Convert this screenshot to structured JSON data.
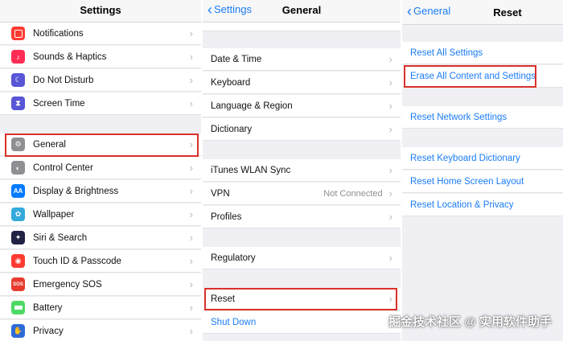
{
  "settings": {
    "title": "Settings",
    "items": [
      {
        "label": "Notifications",
        "icon": "notifications-icon",
        "color": "#ff3b30",
        "glyph": "▢"
      },
      {
        "label": "Sounds & Haptics",
        "icon": "sounds-icon",
        "color": "#ff2d55",
        "glyph": "🔊"
      },
      {
        "label": "Do Not Disturb",
        "icon": "moon-icon",
        "color": "#5856d6",
        "glyph": "☾"
      },
      {
        "label": "Screen Time",
        "icon": "hourglass-icon",
        "color": "#5856d6",
        "glyph": "⧗"
      },
      {
        "label": "General",
        "icon": "gear-icon",
        "color": "#8e8e93",
        "glyph": "⚙"
      },
      {
        "label": "Control Center",
        "icon": "toggles-icon",
        "color": "#8e8e93",
        "glyph": "◐"
      },
      {
        "label": "Display & Brightness",
        "icon": "display-icon",
        "color": "#007aff",
        "glyph": "AA"
      },
      {
        "label": "Wallpaper",
        "icon": "wallpaper-icon",
        "color": "#34aadc",
        "glyph": "✿"
      },
      {
        "label": "Siri & Search",
        "icon": "siri-icon",
        "color": "#222244",
        "glyph": "✦"
      },
      {
        "label": "Touch ID & Passcode",
        "icon": "fingerprint-icon",
        "color": "#ff3b30",
        "glyph": "◉"
      },
      {
        "label": "Emergency SOS",
        "icon": "sos-icon",
        "color": "#e63b2e",
        "glyph": "SOS"
      },
      {
        "label": "Battery",
        "icon": "battery-icon",
        "color": "#4cd964",
        "glyph": "▬"
      },
      {
        "label": "Privacy",
        "icon": "hand-icon",
        "color": "#2f6bd8",
        "glyph": "✋"
      }
    ]
  },
  "general": {
    "back_label": "Settings",
    "title": "General",
    "partial_text": "...",
    "items": [
      {
        "label": "Date & Time"
      },
      {
        "label": "Keyboard"
      },
      {
        "label": "Language & Region"
      },
      {
        "label": "Dictionary"
      },
      {
        "label": "iTunes WLAN Sync"
      },
      {
        "label": "VPN",
        "value": "Not Connected"
      },
      {
        "label": "Profiles"
      },
      {
        "label": "Regulatory"
      },
      {
        "label": "Reset"
      },
      {
        "label": "Shut Down"
      }
    ]
  },
  "reset": {
    "back_label": "General",
    "title": "Reset",
    "items": [
      {
        "label": "Reset All Settings"
      },
      {
        "label": "Erase All Content and Settings"
      },
      {
        "label": "Reset Network Settings"
      },
      {
        "label": "Reset Keyboard Dictionary"
      },
      {
        "label": "Reset Home Screen Layout"
      },
      {
        "label": "Reset Location & Privacy"
      }
    ]
  },
  "watermark": "掘金技术社区 @ 实用软件助手",
  "chevron": "›",
  "back_chevron": "‹",
  "colors": {
    "accent": "#1a7cf5",
    "highlight": "#d9302a"
  }
}
